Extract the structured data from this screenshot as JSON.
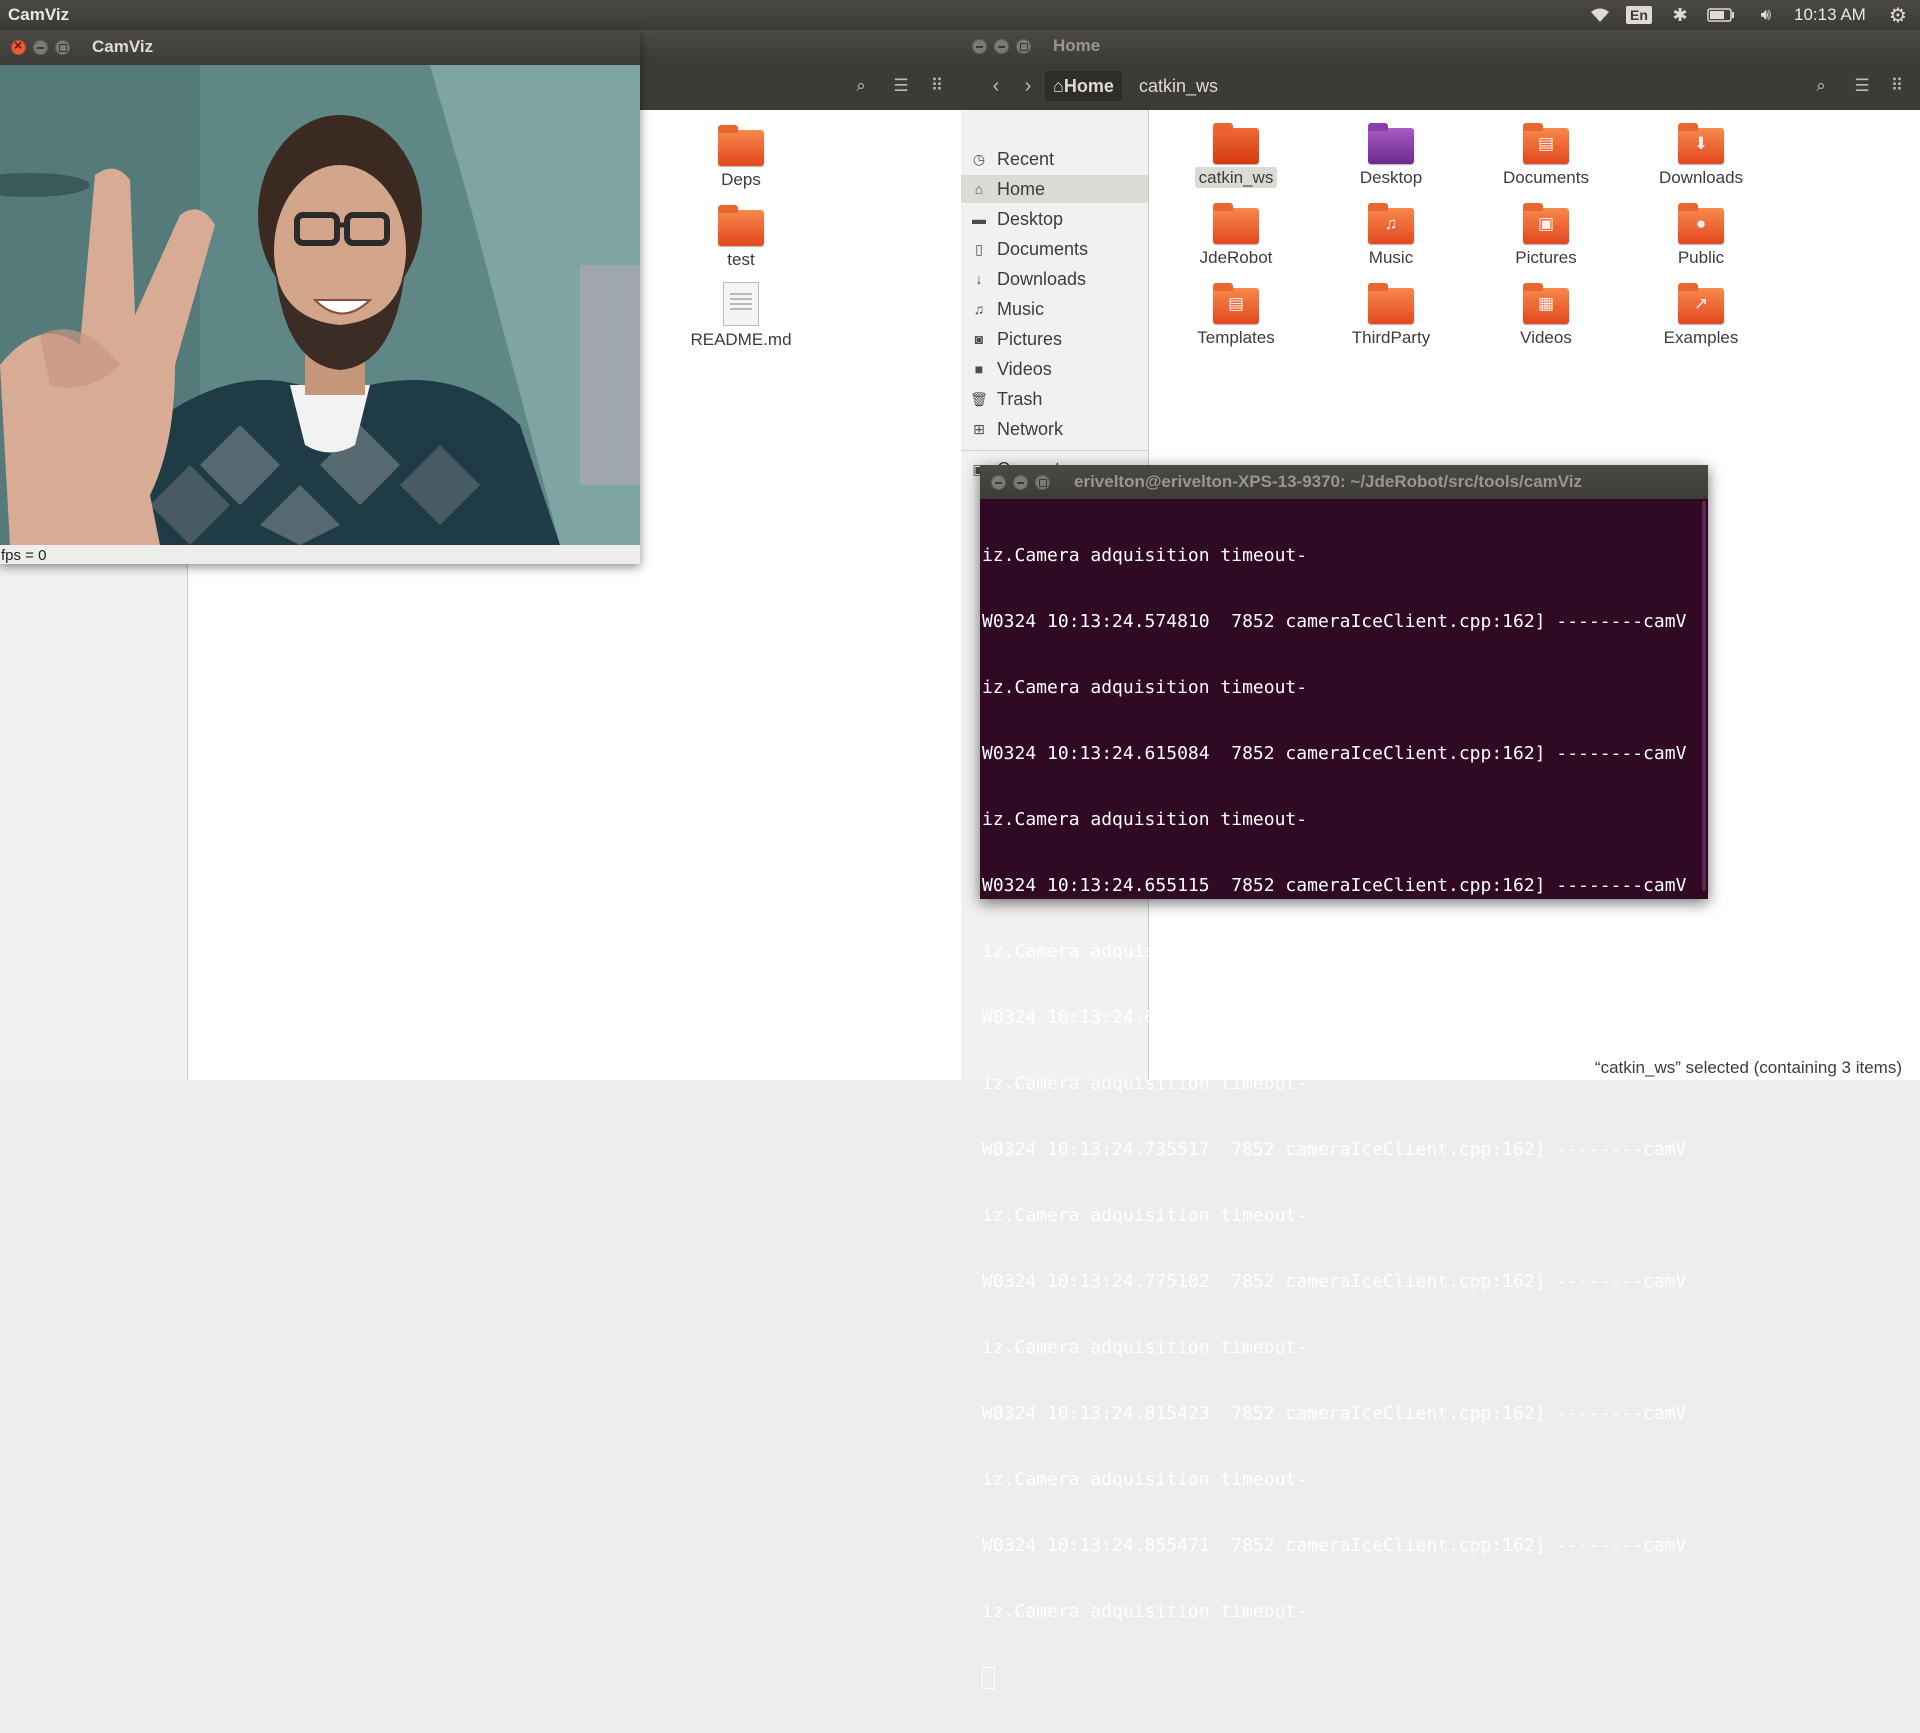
{
  "topbar": {
    "app_name": "CamViz",
    "lang": "En",
    "clock": "10:13 AM"
  },
  "back_fm": {
    "files": [
      {
        "name": "Deps",
        "type": "folder"
      },
      {
        "name": "test",
        "type": "folder"
      },
      {
        "name": "README.md",
        "type": "document"
      }
    ]
  },
  "camviz": {
    "title": "CamViz",
    "fps_label": "fps = 0"
  },
  "main_fm": {
    "title": "Home",
    "breadcrumb": [
      "Home",
      "catkin_ws"
    ],
    "sidebar": [
      {
        "label": "Recent",
        "icon": "clock-icon"
      },
      {
        "label": "Home",
        "icon": "home-icon"
      },
      {
        "label": "Desktop",
        "icon": "desktop-icon"
      },
      {
        "label": "Documents",
        "icon": "document-icon"
      },
      {
        "label": "Downloads",
        "icon": "download-icon"
      },
      {
        "label": "Music",
        "icon": "music-icon"
      },
      {
        "label": "Pictures",
        "icon": "camera-icon"
      },
      {
        "label": "Videos",
        "icon": "video-icon"
      },
      {
        "label": "Trash",
        "icon": "trash-icon"
      },
      {
        "label": "Network",
        "icon": "network-icon"
      },
      {
        "label": "Computer",
        "icon": "computer-icon"
      }
    ],
    "files": [
      {
        "name": "catkin_ws",
        "glyph": ""
      },
      {
        "name": "Desktop",
        "glyph": ""
      },
      {
        "name": "Documents",
        "glyph": "▤"
      },
      {
        "name": "Downloads",
        "glyph": "⬇"
      },
      {
        "name": "JdeRobot",
        "glyph": ""
      },
      {
        "name": "Music",
        "glyph": "♫"
      },
      {
        "name": "Pictures",
        "glyph": "▣"
      },
      {
        "name": "Public",
        "glyph": "●"
      },
      {
        "name": "Templates",
        "glyph": "▤"
      },
      {
        "name": "ThirdParty",
        "glyph": ""
      },
      {
        "name": "Videos",
        "glyph": "▦"
      },
      {
        "name": "Examples",
        "glyph": "↗"
      }
    ],
    "status": "“catkin_ws” selected  (containing 3 items)"
  },
  "terminal": {
    "title": "erivelton@erivelton-XPS-13-9370: ~/JdeRobot/src/tools/camViz",
    "lines": [
      "iz.Camera adquisition timeout-",
      "W0324 10:13:24.574810  7852 cameraIceClient.cpp:162] --------camV",
      "iz.Camera adquisition timeout-",
      "W0324 10:13:24.615084  7852 cameraIceClient.cpp:162] --------camV",
      "iz.Camera adquisition timeout-",
      "W0324 10:13:24.655115  7852 cameraIceClient.cpp:162] --------camV",
      "iz.Camera adquisition timeout-",
      "W0324 10:13:24.694977  7852 cameraIceClient.cpp:162] --------camV",
      "iz.Camera adquisition timeout-",
      "W0324 10:13:24.735517  7852 cameraIceClient.cpp:162] --------camV",
      "iz.Camera adquisition timeout-",
      "W0324 10:13:24.775102  7852 cameraIceClient.cpp:162] --------camV",
      "iz.Camera adquisition timeout-",
      "W0324 10:13:24.815423  7852 cameraIceClient.cpp:162] --------camV",
      "iz.Camera adquisition timeout-",
      "W0324 10:13:24.855471  7852 cameraIceClient.cpp:162] --------camV",
      "iz.Camera adquisition timeout-"
    ]
  }
}
